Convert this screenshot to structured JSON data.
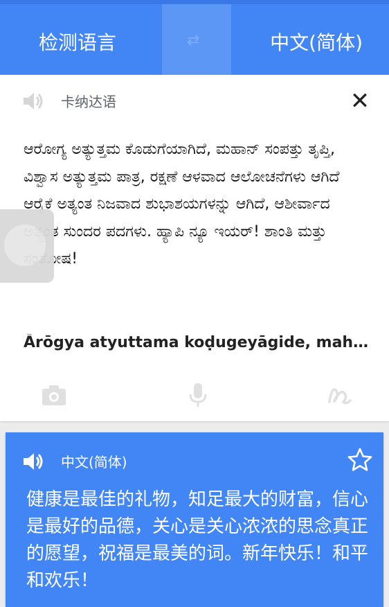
{
  "header": {
    "source_language": "检测语言",
    "target_language": "中文(简体)"
  },
  "source": {
    "detected_language": "卡纳达语",
    "text": "ಆರೋಗ್ಯ ಅತ್ಯುತ್ತಮ ಕೊಡುಗೆಯಾಗಿದೆ, ಮಹಾನ್ ಸಂಪತ್ತು ತೃಪ್ತಿ, ವಿಶ್ವಾಸ ಅತ್ಯುತ್ತಮ ಪಾತ್ರ, ರಕ್ಷಣೆ ಆಳವಾದ ಆಲೋಚನೆಗಳು ಆಗಿದೆ ಆರೈಕೆ ಅತ್ಯಂತ ನಿಜವಾದ ಶುಭಾಶಯಗಳನ್ನು ಆಗಿದೆ, ಆಶೀರ್ವಾದ ಅತ್ಯಂತ ಸುಂದರ ಪದಗಳು. ಹ್ಯಾಪಿ ನ್ಯೂ ಇಯರ್! ಶಾಂತಿ ಮತ್ತು ಸಂತೋಷ!",
    "transliteration": "Ārōgya atyuttama koḍugeyāgide, mahā..."
  },
  "result": {
    "language": "中文(简体)",
    "text": "健康是最佳的礼物，知足最大的财富，信心是最好的品德，关心是关心浓浓的思念真正的愿望，祝福是最美的词。新年快乐！和平和欢乐！"
  },
  "colors": {
    "accent": "#4285f4",
    "card_bg": "#ffffff",
    "icon_grey": "#c8c8c8"
  },
  "icons": {
    "swap": "swap-icon",
    "speaker": "speaker-icon",
    "close": "close-icon",
    "camera": "camera-icon",
    "mic": "microphone-icon",
    "handwriting": "handwriting-icon",
    "star": "star-icon"
  }
}
